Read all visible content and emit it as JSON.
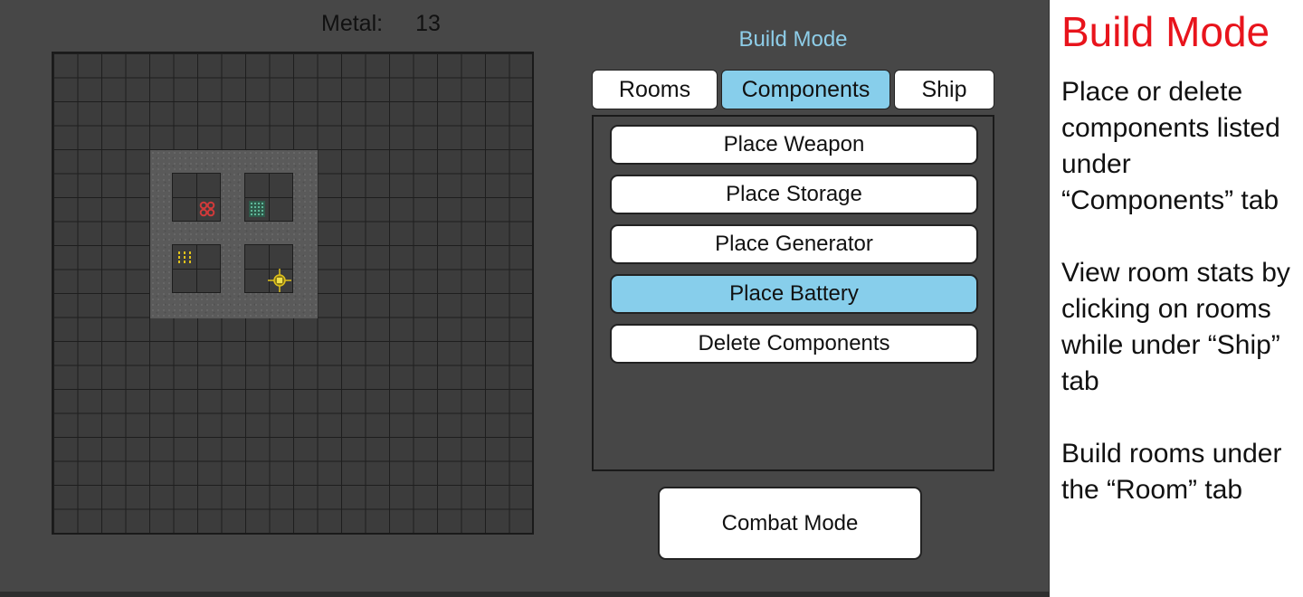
{
  "resources": {
    "metal_label": "Metal:",
    "metal_value": "13"
  },
  "panel": {
    "title": "Build Mode"
  },
  "tabs": [
    {
      "label": "Rooms",
      "active": false
    },
    {
      "label": "Components",
      "active": true
    },
    {
      "label": "Ship",
      "active": false
    }
  ],
  "components": [
    {
      "label": "Place Weapon",
      "active": false
    },
    {
      "label": "Place Storage",
      "active": false
    },
    {
      "label": "Place Generator",
      "active": false
    },
    {
      "label": "Place Battery",
      "active": true
    },
    {
      "label": "Delete Components",
      "active": false
    }
  ],
  "combat_button": "Combat Mode",
  "help": {
    "title": "Build Mode",
    "paragraphs": [
      "Place or delete components listed under “Components” tab",
      "View room stats by clicking on rooms while under “Ship” tab",
      "Build rooms under the “Room” tab"
    ]
  },
  "colors": {
    "accent": "#87ceeb",
    "title_text": "#8ecde8",
    "help_title": "#e8141c",
    "background": "#474747"
  },
  "ship_rooms": [
    {
      "component": "weapon",
      "icon": "weapon-icon"
    },
    {
      "component": "storage",
      "icon": "storage-icon"
    },
    {
      "component": "generator",
      "icon": "generator-icon"
    },
    {
      "component": "battery",
      "icon": "battery-icon"
    }
  ]
}
